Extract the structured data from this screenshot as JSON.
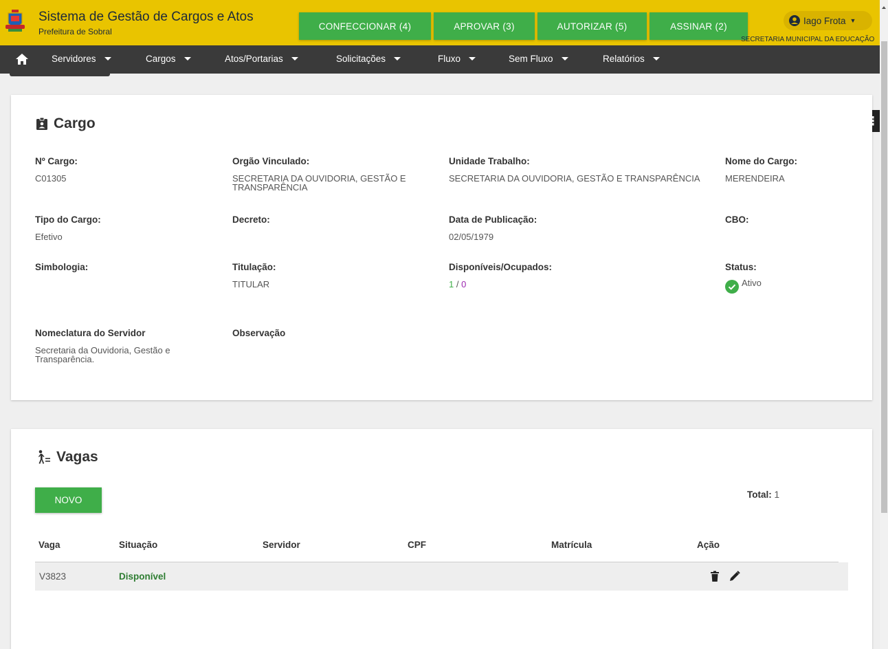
{
  "header": {
    "app_title": "Sistema de Gestão de Cargos e Atos",
    "app_subtitle": "Prefeitura de Sobral",
    "actions": [
      {
        "label": "CONFECCIONAR (4)"
      },
      {
        "label": "APROVAR (3)"
      },
      {
        "label": "AUTORIZAR (5)"
      },
      {
        "label": "ASSINAR (2)"
      }
    ],
    "user_name": "Iago Frota",
    "secretaria": "SECRETARIA MUNICIPAL DA EDUCAÇÃO",
    "accent_color": "#e9c400",
    "action_color": "#3fae49"
  },
  "nav": {
    "items": [
      "Servidores",
      "Cargos",
      "Atos/Portarias",
      "Solicitações",
      "Fluxo",
      "Sem Fluxo",
      "Relatórios"
    ],
    "background": "#3a3a3a"
  },
  "cargo": {
    "title": "Cargo",
    "fields": {
      "numero": {
        "label": "Nº Cargo:",
        "value": "C01305"
      },
      "orgao": {
        "label": "Orgão Vinculado:",
        "value": "SECRETARIA DA OUVIDORIA, GESTÃO E TRANSPARÊNCIA"
      },
      "unidade": {
        "label": "Unidade Trabalho:",
        "value": "SECRETARIA DA OUVIDORIA, GESTÃO E TRANSPARÊNCIA"
      },
      "nome": {
        "label": "Nome do Cargo:",
        "value": "MERENDEIRA"
      },
      "tipo": {
        "label": "Tipo do Cargo:",
        "value": "Efetivo"
      },
      "decreto": {
        "label": "Decreto:",
        "value": ""
      },
      "data_pub": {
        "label": "Data de Publicação:",
        "value": "02/05/1979"
      },
      "cbo": {
        "label": "CBO:",
        "value": ""
      },
      "simbologia": {
        "label": "Simbologia:",
        "value": ""
      },
      "titulacao": {
        "label": "Titulação:",
        "value": "TITULAR"
      },
      "disponiveis": {
        "label": "Disponíveis/Ocupados:",
        "disponiveis": "1",
        "separator": " / ",
        "ocupados": "0"
      },
      "status": {
        "label": "Status:",
        "value": "Ativo"
      },
      "nomeclatura": {
        "label": "Nomeclatura do Servidor",
        "value": "Secretaria da Ouvidoria, Gestão e Transparência."
      },
      "observacao": {
        "label": "Observação",
        "value": ""
      }
    }
  },
  "vagas": {
    "title": "Vagas",
    "novo_label": "NOVO",
    "total_label": "Total:",
    "total_value": "1",
    "columns": [
      "Vaga",
      "Situação",
      "Servidor",
      "CPF",
      "Matrícula",
      "Ação"
    ],
    "rows": [
      {
        "vaga": "V3823",
        "situacao": "Disponível",
        "servidor": "",
        "cpf": "",
        "matricula": ""
      }
    ]
  }
}
